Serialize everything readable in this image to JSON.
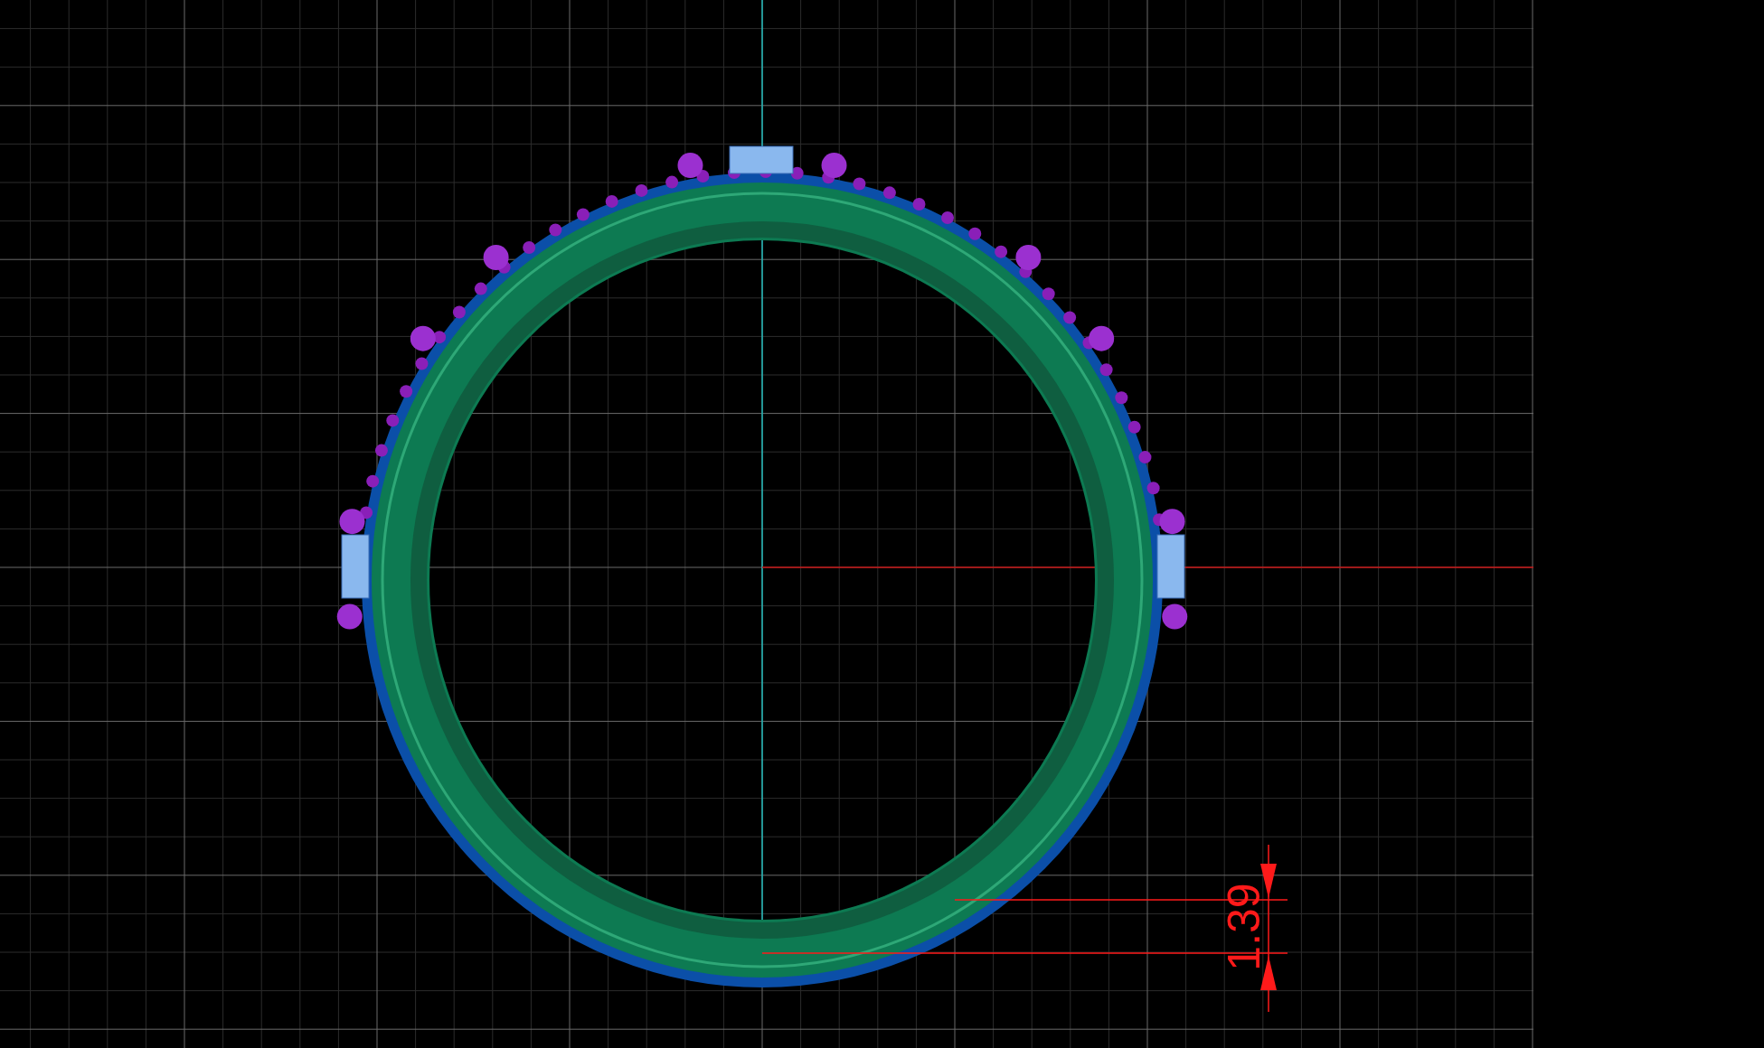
{
  "viewport": {
    "dimension": {
      "value": "1.39"
    }
  }
}
